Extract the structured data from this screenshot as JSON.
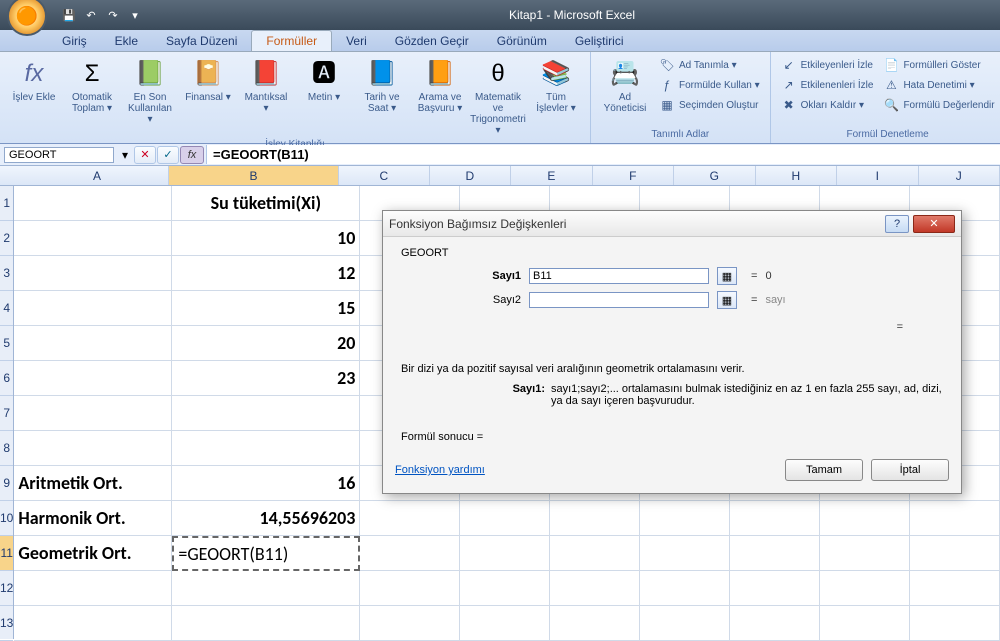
{
  "window": {
    "title": "Kitap1 - Microsoft Excel"
  },
  "tabs": {
    "home": "Giriş",
    "insert": "Ekle",
    "layout": "Sayfa Düzeni",
    "formulas": "Formüller",
    "data": "Veri",
    "review": "Gözden Geçir",
    "view": "Görünüm",
    "developer": "Geliştirici"
  },
  "ribbon": {
    "fx": "İşlev Ekle",
    "autosum": "Otomatik Toplam ▾",
    "recent": "En Son Kullanılan ▾",
    "financial": "Finansal ▾",
    "logical": "Mantıksal ▾",
    "text": "Metin ▾",
    "datetime": "Tarih ve Saat ▾",
    "lookup": "Arama ve Başvuru ▾",
    "math": "Matematik ve Trigonometri ▾",
    "more": "Tüm İşlevler ▾",
    "lib_label": "İşlev Kitaplığı",
    "name_mgr": "Ad Yöneticisi",
    "define_name": "Ad Tanımla ▾",
    "use_formula": "Formülde Kullan ▾",
    "create_sel": "Seçimden Oluştur",
    "names_label": "Tanımlı Adlar",
    "trace_prec": "Etkileyenleri İzle",
    "trace_dep": "Etkilenenleri İzle",
    "remove_arrows": "Okları Kaldır ▾",
    "show_formulas": "Formülleri Göster",
    "error_check": "Hata Denetimi ▾",
    "eval_formula": "Formülü Değerlendir",
    "audit_label": "Formül Denetleme"
  },
  "namebox": "GEOORT",
  "formula": "=GEOORT(B11)",
  "headers": {
    "A": "A",
    "B": "B",
    "C": "C",
    "D": "D",
    "E": "E",
    "F": "F",
    "G": "G",
    "H": "H",
    "I": "I",
    "J": "J"
  },
  "rows": {
    "1": {
      "A": "",
      "B": "Su tüketimi(Xi)"
    },
    "2": {
      "B": "10"
    },
    "3": {
      "B": "12"
    },
    "4": {
      "B": "15"
    },
    "5": {
      "B": "20"
    },
    "6": {
      "B": "23"
    },
    "7": {},
    "8": {},
    "9": {
      "A": "Aritmetik Ort.",
      "B": "16"
    },
    "10": {
      "A": "Harmonik Ort.",
      "B": "14,55696203"
    },
    "11": {
      "A": "Geometrik Ort.",
      "B": "=GEOORT(B11)"
    },
    "12": {},
    "13": {}
  },
  "dialog": {
    "title": "Fonksiyon Bağımsız Değişkenleri",
    "fn": "GEOORT",
    "arg1_label": "Sayı1",
    "arg1_value": "B11",
    "arg1_result": "0",
    "arg2_label": "Sayı2",
    "arg2_value": "",
    "arg2_result": "sayı",
    "eq": "=",
    "desc": "Bir dizi ya da pozitif sayısal veri aralığının geometrik ortalamasını verir.",
    "param_label": "Sayı1:",
    "param_desc": "sayı1;sayı2;... ortalamasını bulmak istediğiniz en az 1 en fazla 255 sayı, ad, dizi, ya da sayı içeren başvurudur.",
    "result_label": "Formül sonucu =",
    "help": "Fonksiyon yardımı",
    "ok": "Tamam",
    "cancel": "İptal"
  }
}
